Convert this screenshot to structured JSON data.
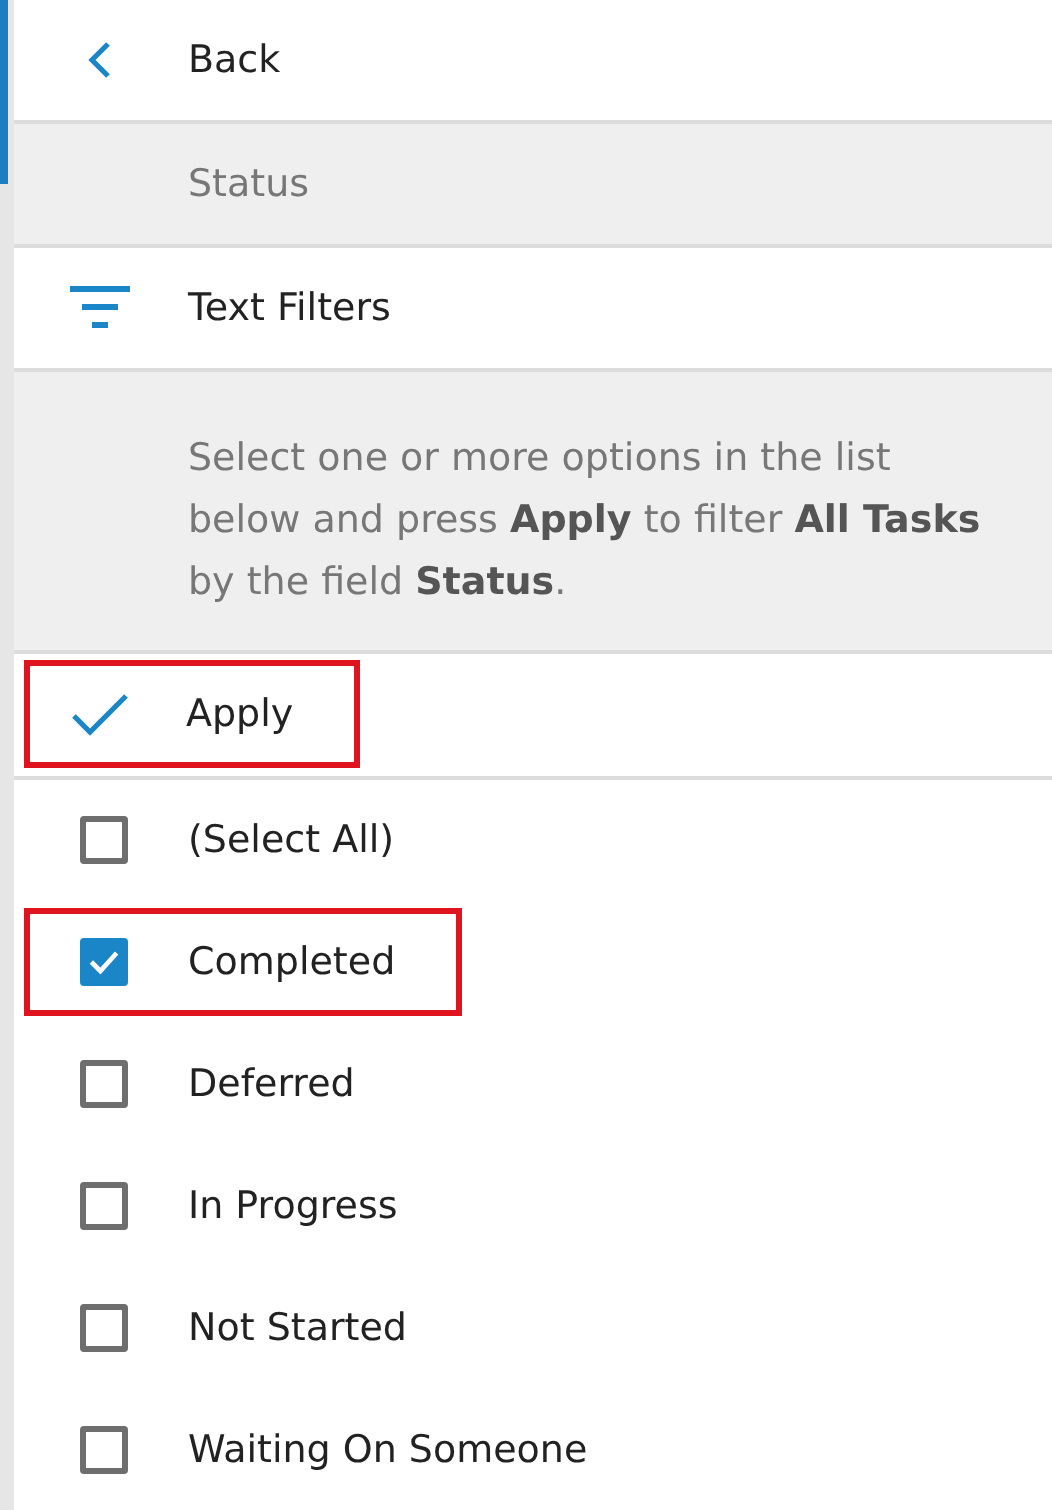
{
  "back": {
    "label": "Back"
  },
  "field_header": {
    "label": "Status"
  },
  "text_filters": {
    "label": "Text Filters"
  },
  "description": "Select one or more options in the list below and press **Apply** to filter **All Tasks** by the field **Status**.",
  "apply": {
    "label": "Apply",
    "highlighted": true
  },
  "options": [
    {
      "label": "(Select All)",
      "checked": false,
      "highlighted": false
    },
    {
      "label": "Completed",
      "checked": true,
      "highlighted": true
    },
    {
      "label": "Deferred",
      "checked": false,
      "highlighted": false
    },
    {
      "label": "In Progress",
      "checked": false,
      "highlighted": false
    },
    {
      "label": "Not Started",
      "checked": false,
      "highlighted": false
    },
    {
      "label": "Waiting On Someone",
      "checked": false,
      "highlighted": false
    }
  ]
}
